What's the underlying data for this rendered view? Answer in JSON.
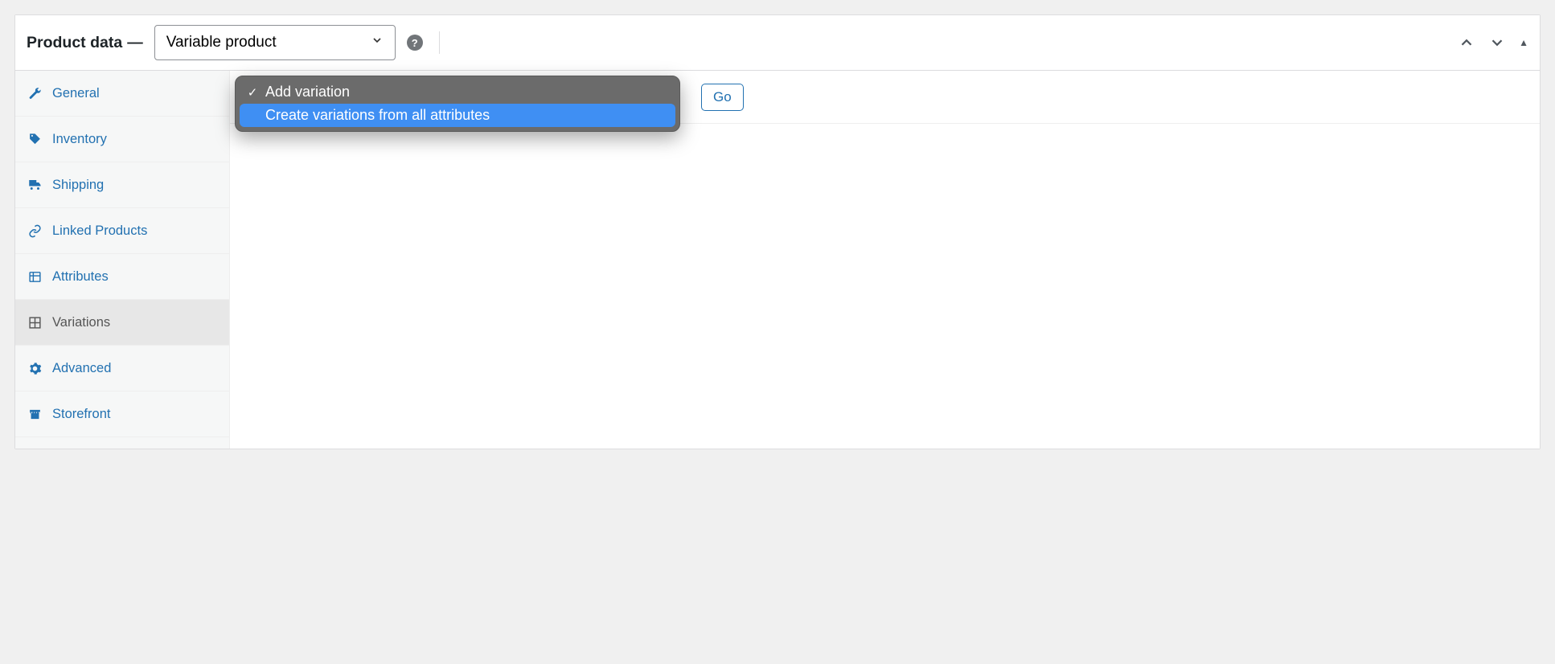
{
  "header": {
    "title": "Product data",
    "dash": "—",
    "type_select_value": "Variable product"
  },
  "sidebar": {
    "items": [
      {
        "label": "General"
      },
      {
        "label": "Inventory"
      },
      {
        "label": "Shipping"
      },
      {
        "label": "Linked Products"
      },
      {
        "label": "Attributes"
      },
      {
        "label": "Variations"
      },
      {
        "label": "Advanced"
      },
      {
        "label": "Storefront"
      }
    ]
  },
  "toolbar": {
    "go_label": "Go"
  },
  "dropdown": {
    "options": [
      {
        "label": "Add variation",
        "selected": true
      },
      {
        "label": "Create variations from all attributes",
        "highlighted": true
      }
    ]
  }
}
